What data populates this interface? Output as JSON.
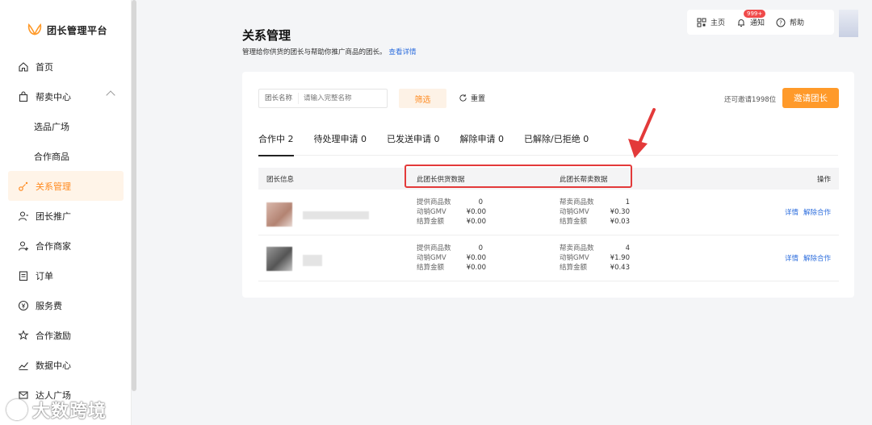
{
  "app": {
    "title": "团长管理平台"
  },
  "sidebar": {
    "items": [
      {
        "label": "首页",
        "icon": "home-icon"
      },
      {
        "label": "帮卖中心",
        "icon": "bag-icon"
      },
      {
        "label": "选品广场",
        "sub": true
      },
      {
        "label": "合作商品",
        "sub": true
      },
      {
        "label": "关系管理",
        "icon": "relation-icon",
        "active": true
      },
      {
        "label": "团长推广",
        "icon": "promote-icon"
      },
      {
        "label": "合作商家",
        "icon": "merchant-icon"
      },
      {
        "label": "订单",
        "icon": "order-icon"
      },
      {
        "label": "服务费",
        "icon": "yuan-icon"
      },
      {
        "label": "合作激励",
        "icon": "reward-icon"
      },
      {
        "label": "数据中心",
        "icon": "chart-icon"
      },
      {
        "label": "达人广场",
        "icon": "mail-icon"
      }
    ]
  },
  "watermark": {
    "text": "大数跨境"
  },
  "topbar": {
    "home_label": "主页",
    "notify_label": "通知",
    "notify_badge": "999+",
    "help_label": "帮助"
  },
  "page": {
    "title": "关系管理",
    "desc": "管理给你供货的团长与帮助你推广商品的团长。",
    "desc_link": "查看详情"
  },
  "filter": {
    "label": "团长名称",
    "placeholder": "请输入完整名称",
    "filter_btn": "筛选",
    "reset_btn": "重置",
    "remain_text": "还可邀请1998位",
    "invite_btn": "邀请团长"
  },
  "tabs": [
    {
      "label": "合作中 2",
      "active": true
    },
    {
      "label": "待处理申请 0"
    },
    {
      "label": "已发送申请 0"
    },
    {
      "label": "解除申请 0"
    },
    {
      "label": "已解除/已拒绝 0"
    }
  ],
  "table": {
    "headers": {
      "info": "团长信息",
      "supply": "此团长供货数据",
      "sell": "此团长帮卖数据",
      "ops": "操作"
    },
    "rows": [
      {
        "supply": [
          [
            "提供商品数",
            "0"
          ],
          [
            "动销GMV",
            "¥0.00"
          ],
          [
            "结算金额",
            "¥0.00"
          ]
        ],
        "sell": [
          [
            "帮卖商品数",
            "1"
          ],
          [
            "动销GMV",
            "¥0.30"
          ],
          [
            "结算金额",
            "¥0.03"
          ]
        ],
        "op_detail": "详情",
        "op_remove": "解除合作"
      },
      {
        "supply": [
          [
            "提供商品数",
            "0"
          ],
          [
            "动销GMV",
            "¥0.00"
          ],
          [
            "结算金额",
            "¥0.00"
          ]
        ],
        "sell": [
          [
            "帮卖商品数",
            "4"
          ],
          [
            "动销GMV",
            "¥1.90"
          ],
          [
            "结算金额",
            "¥0.43"
          ]
        ],
        "op_detail": "详情",
        "op_remove": "解除合作"
      }
    ]
  },
  "colors": {
    "accent": "#ff9a2a",
    "link": "#2f6fde",
    "annotation": "#e33a3a"
  }
}
